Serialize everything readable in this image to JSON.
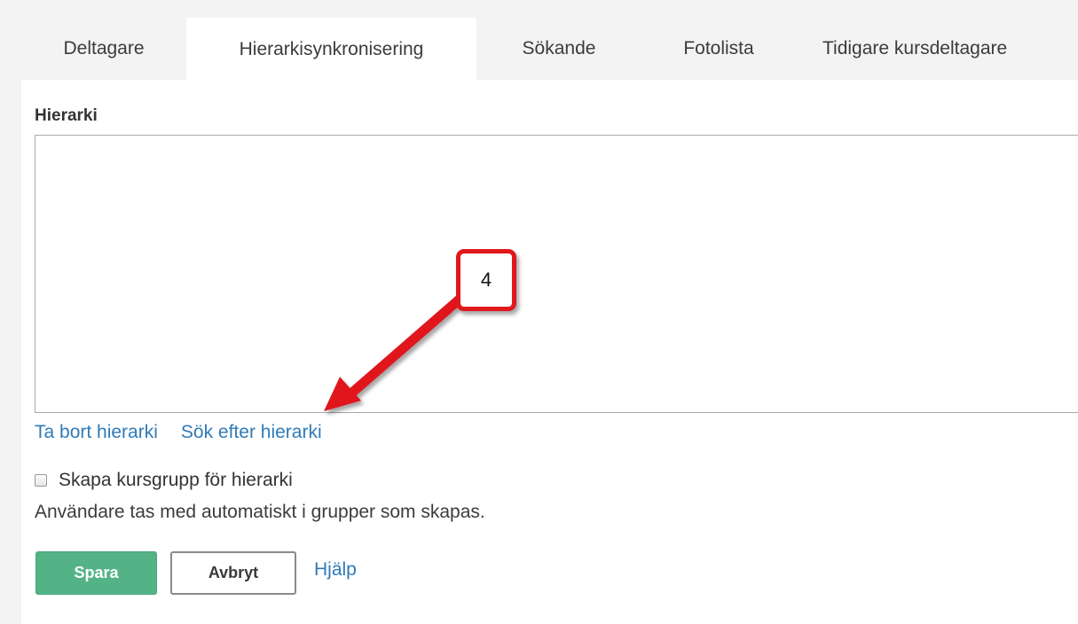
{
  "tabs": [
    {
      "label": "Deltagare",
      "active": false
    },
    {
      "label": "Hierarkisynkronisering",
      "active": true
    },
    {
      "label": "Sökande",
      "active": false
    },
    {
      "label": "Fotolista",
      "active": false
    },
    {
      "label": "Tidigare kursdeltagare",
      "active": false
    }
  ],
  "hierarchy": {
    "label": "Hierarki",
    "remove_link": "Ta bort hierarki",
    "search_link": "Sök efter hierarki"
  },
  "course_group": {
    "checkbox_label": "Skapa kursgrupp för hierarki",
    "checked": false,
    "help_text": "Användare tas med automatiskt i grupper som skapas."
  },
  "actions": {
    "save": "Spara",
    "cancel": "Avbryt",
    "help": "Hjälp"
  },
  "annotation": {
    "step_number": "4",
    "color": "#e0171b"
  },
  "colors": {
    "primary_button": "#53b387",
    "link": "#2f7ab8",
    "page_background": "#f3f3f3"
  }
}
